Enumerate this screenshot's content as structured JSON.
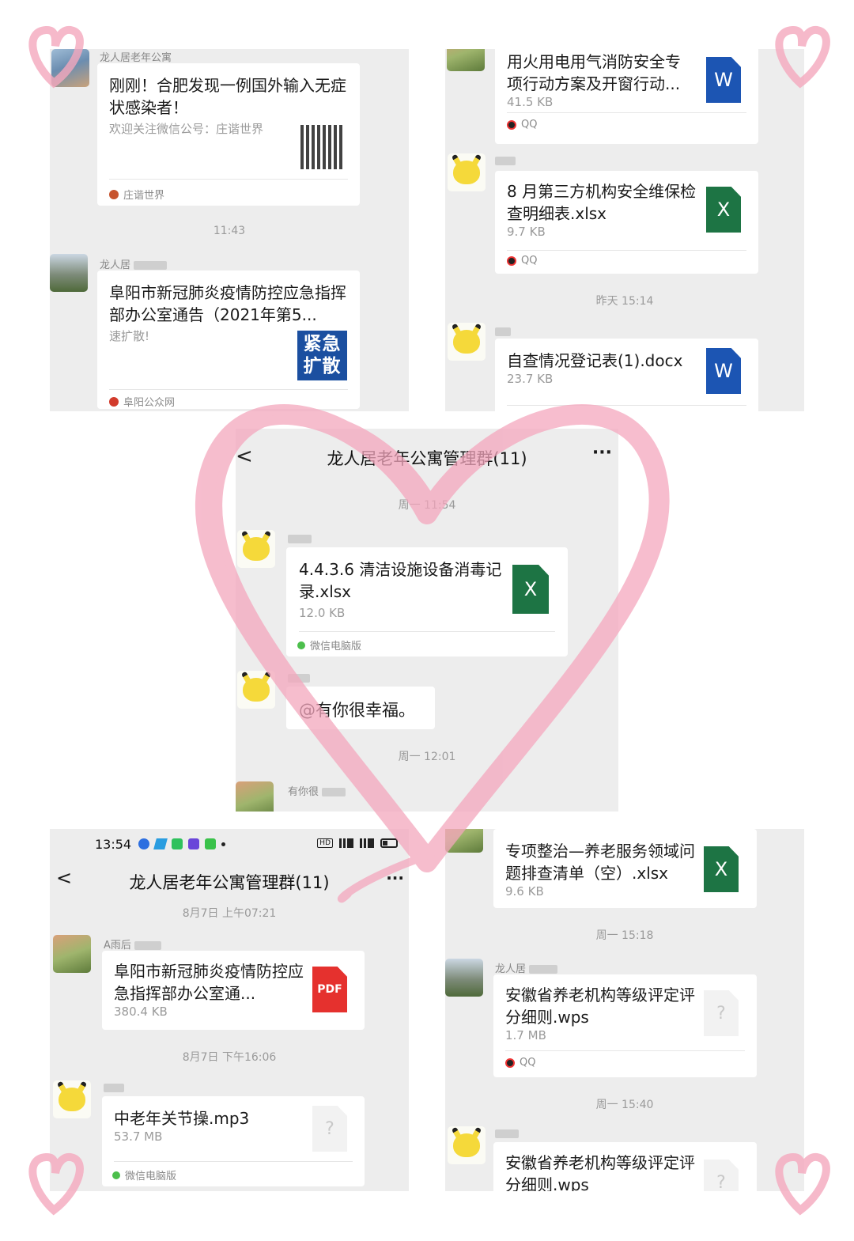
{
  "p1": {
    "sender1": "龙人居老年公寓",
    "card1_title": "刚刚！合肥发现一例国外输入无症状感染者！",
    "card1_sub": "欢迎关注微信公号：庄谐世界",
    "card1_source": "庄谐世界",
    "time1": "11:43",
    "sender2": "龙人居",
    "card2_title": "阜阳市新冠肺炎疫情防控应急指挥部办公室通告（2021年第5...",
    "card2_sub": "速扩散!",
    "card2_badge": "紧急扩散",
    "card2_source": "阜阳公众网"
  },
  "p2": {
    "f1_name": "用火用电用气消防安全专项行动方案及开窗行动...",
    "f1_size": "41.5 KB",
    "f1_icon": "W",
    "f1_source": "QQ",
    "f2_name": "8 月第三方机构安全维保检查明细表.xlsx",
    "f2_size": "9.7 KB",
    "f2_icon": "X",
    "f2_source": "QQ",
    "time1": "昨天 15:14",
    "f3_name": "自查情况登记表(1).docx",
    "f3_size": "23.7 KB",
    "f3_icon": "W"
  },
  "p3": {
    "title": "龙人居老年公寓管理群(11)",
    "back": "<",
    "more": "···",
    "time1": "周一 11:54",
    "f1_name": "4.4.3.6 清洁设施设备消毒记录.xlsx",
    "f1_size": "12.0 KB",
    "f1_icon": "X",
    "f1_source": "微信电脑版",
    "msg2": "@有你很幸福。",
    "time2": "周一 12:01",
    "sender3": "有你很"
  },
  "p4": {
    "status_time": "13:54",
    "title": "龙人居老年公寓管理群(11)",
    "back": "<",
    "more": "···",
    "time1": "8月7日 上午07:21",
    "sender1": "A雨后",
    "f1_name": "阜阳市新冠肺炎疫情防控应急指挥部办公室通...",
    "f1_size": "380.4 KB",
    "f1_icon": "PDF",
    "time2": "8月7日 下午16:06",
    "f2_name": "中老年关节操.mp3",
    "f2_size": "53.7 MB",
    "f2_icon": "?",
    "f2_source": "微信电脑版"
  },
  "p5": {
    "f1_name": "专项整治—养老服务领域问题排查清单（空）.xlsx",
    "f1_size": "9.6 KB",
    "f1_icon": "X",
    "time1": "周一 15:18",
    "sender2": "龙人居",
    "f2_name": "安徽省养老机构等级评定评分细则.wps",
    "f2_size": "1.7 MB",
    "f2_icon": "?",
    "f2_source": "QQ",
    "time2": "周一 15:40",
    "f3_name": "安徽省养老机构等级评定评分细则.wps",
    "f3_icon": "?"
  },
  "colors": {
    "word": "#1c55b3",
    "excel": "#1d7444",
    "pdf": "#e5312e",
    "heart": "#f4a7bd"
  }
}
